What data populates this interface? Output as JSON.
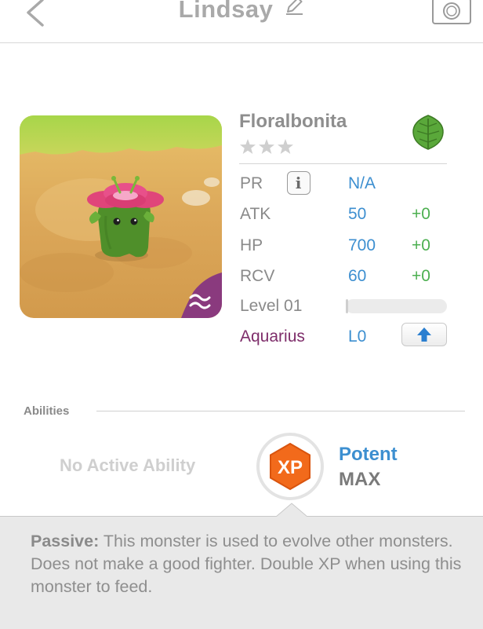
{
  "header": {
    "title": "Lindsay",
    "back_icon": "chevron-left-icon",
    "edit_icon": "pencil-icon",
    "camera_icon": "camera-icon"
  },
  "monster": {
    "name": "Floralbonita",
    "rarity_stars": 3,
    "element_icon": "leaf-icon",
    "element_color": "#5aa83a",
    "type_icon": "wave-icon"
  },
  "stats": {
    "pr": {
      "label": "PR",
      "value": "N/A"
    },
    "atk": {
      "label": "ATK",
      "value": "50",
      "bonus": "+0"
    },
    "hp": {
      "label": "HP",
      "value": "700",
      "bonus": "+0"
    },
    "rcv": {
      "label": "RCV",
      "value": "60",
      "bonus": "+0"
    },
    "level": {
      "label": "Level 01",
      "progress": 0.01
    },
    "latent": {
      "label": "Aquarius",
      "value": "L0"
    }
  },
  "abilities": {
    "section_label": "Abilities",
    "active": "No Active Ability",
    "badge_text": "XP",
    "badge_color": "#f26a1b",
    "potency": "Potent",
    "potency_level": "MAX"
  },
  "passive": {
    "label": "Passive:",
    "text": " This monster is used to evolve other monsters. Does not make a good fighter. Double XP when using this monster to feed."
  },
  "colors": {
    "value_blue": "#3d8fd0",
    "bonus_green": "#4caf50",
    "latent_purple": "#7e2d6a"
  }
}
